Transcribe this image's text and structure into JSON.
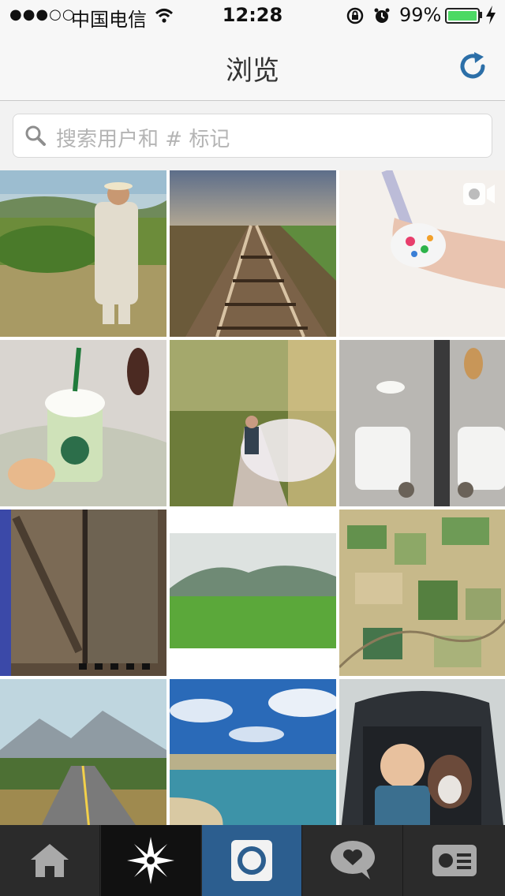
{
  "status_bar": {
    "signal": "●●●○○",
    "carrier": "中国电信",
    "time": "12:28",
    "battery_percent": "99%",
    "battery_level": 0.99,
    "battery_color": "#4cd964"
  },
  "nav": {
    "title": "浏览",
    "refresh_icon": "refresh-icon",
    "accent_color": "#2c6fa8"
  },
  "search": {
    "placeholder": "搜索用户和 # 标记",
    "icon": "search-icon"
  },
  "photos": [
    {
      "subject": "man in suit on hillside",
      "media": "photo"
    },
    {
      "subject": "railroad tracks at sunset",
      "media": "photo"
    },
    {
      "subject": "painted fingernail",
      "media": "video"
    },
    {
      "subject": "starbucks frappuccino",
      "media": "photo"
    },
    {
      "subject": "man with smoke on forest path",
      "media": "photo"
    },
    {
      "subject": "white armchair with cat and guitar",
      "media": "photo"
    },
    {
      "subject": "old wooden barn door",
      "media": "photo"
    },
    {
      "subject": "green rice field and mountains",
      "media": "photo"
    },
    {
      "subject": "aerial farmland",
      "media": "photo"
    },
    {
      "subject": "road toward mountains",
      "media": "photo"
    },
    {
      "subject": "beach and ocean",
      "media": "photo"
    },
    {
      "subject": "child and dog in car",
      "media": "photo"
    }
  ],
  "tab_bar": {
    "tabs": [
      {
        "name": "home",
        "icon": "home-icon"
      },
      {
        "name": "explore",
        "icon": "compass-star-icon",
        "selected": true
      },
      {
        "name": "camera",
        "icon": "camera-icon"
      },
      {
        "name": "activity",
        "icon": "heart-bubble-icon"
      },
      {
        "name": "profile",
        "icon": "profile-card-icon"
      }
    ],
    "camera_color": "#2c5e8f"
  }
}
